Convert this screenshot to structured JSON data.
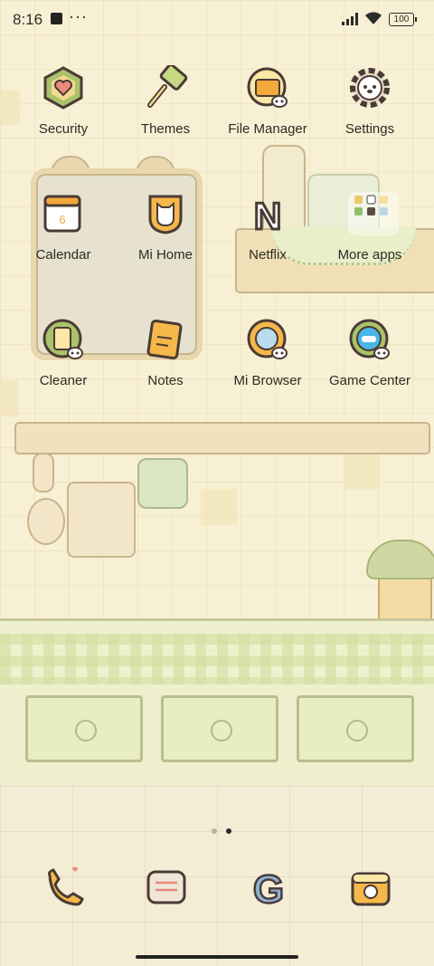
{
  "status_bar": {
    "time": "8:16",
    "more": "···",
    "battery": "100"
  },
  "apps": [
    {
      "name": "Security",
      "icon": "security-icon"
    },
    {
      "name": "Themes",
      "icon": "themes-icon"
    },
    {
      "name": "File Manager",
      "icon": "file-manager-icon"
    },
    {
      "name": "Settings",
      "icon": "settings-icon"
    },
    {
      "name": "Calendar",
      "icon": "calendar-icon",
      "badge": "6"
    },
    {
      "name": "Mi Home",
      "icon": "mi-home-icon"
    },
    {
      "name": "Netflix",
      "icon": "netflix-icon",
      "letter": "N"
    },
    {
      "name": "More apps",
      "icon": "folder-icon"
    },
    {
      "name": "Cleaner",
      "icon": "cleaner-icon"
    },
    {
      "name": "Notes",
      "icon": "notes-icon"
    },
    {
      "name": "Mi Browser",
      "icon": "mi-browser-icon"
    },
    {
      "name": "Game Center",
      "icon": "game-center-icon"
    }
  ],
  "dock": [
    {
      "icon": "phone-icon"
    },
    {
      "icon": "messages-icon"
    },
    {
      "icon": "google-icon",
      "letter": "G"
    },
    {
      "icon": "camera-icon"
    }
  ],
  "page_indicator": {
    "pages": 2,
    "current": 2
  },
  "colors": {
    "outline": "#4a3b36",
    "cream": "#f8f0d4",
    "accent_orange": "#f4a93b",
    "accent_green": "#a9c36a"
  }
}
